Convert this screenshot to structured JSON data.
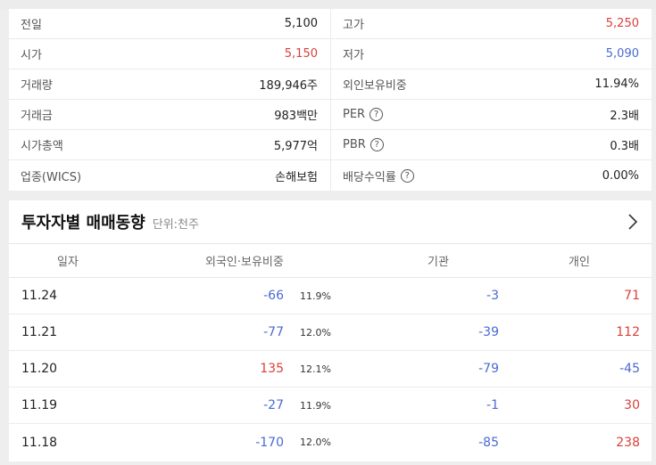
{
  "info": {
    "left": [
      {
        "label": "전일",
        "value": "5,100",
        "tone": "neutral",
        "help": false
      },
      {
        "label": "시가",
        "value": "5,150",
        "tone": "up",
        "help": false
      },
      {
        "label": "거래량",
        "value": "189,946주",
        "tone": "neutral",
        "help": false
      },
      {
        "label": "거래금",
        "value": "983백만",
        "tone": "neutral",
        "help": false
      },
      {
        "label": "시가총액",
        "value": "5,977억",
        "tone": "neutral",
        "help": false
      },
      {
        "label": "업종(WICS)",
        "value": "손해보험",
        "tone": "neutral",
        "help": false
      }
    ],
    "right": [
      {
        "label": "고가",
        "value": "5,250",
        "tone": "up",
        "help": false
      },
      {
        "label": "저가",
        "value": "5,090",
        "tone": "down",
        "help": false
      },
      {
        "label": "외인보유비중",
        "value": "11.94%",
        "tone": "neutral",
        "help": false
      },
      {
        "label": "PER",
        "value": "2.3배",
        "tone": "neutral",
        "help": true
      },
      {
        "label": "PBR",
        "value": "0.3배",
        "tone": "neutral",
        "help": true
      },
      {
        "label": "배당수익률",
        "value": "0.00%",
        "tone": "neutral",
        "help": true
      }
    ]
  },
  "trading": {
    "title": "투자자별 매매동향",
    "unit": "단위:천주",
    "columns": {
      "date": "일자",
      "foreign": "외국인·보유비중",
      "institution": "기관",
      "individual": "개인"
    },
    "rows": [
      {
        "date": "11.24",
        "foreign": "-66",
        "ratio": "11.9%",
        "institution": "-3",
        "individual": "71"
      },
      {
        "date": "11.21",
        "foreign": "-77",
        "ratio": "12.0%",
        "institution": "-39",
        "individual": "112"
      },
      {
        "date": "11.20",
        "foreign": "135",
        "ratio": "12.1%",
        "institution": "-79",
        "individual": "-45"
      },
      {
        "date": "11.19",
        "foreign": "-27",
        "ratio": "11.9%",
        "institution": "-1",
        "individual": "30"
      },
      {
        "date": "11.18",
        "foreign": "-170",
        "ratio": "12.0%",
        "institution": "-85",
        "individual": "238"
      }
    ]
  },
  "colors": {
    "up": "#d9413b",
    "down": "#4a6ad2"
  },
  "icons": {
    "help": "question-circle-icon",
    "more": "chevron-right-icon"
  },
  "help_glyph": "?"
}
